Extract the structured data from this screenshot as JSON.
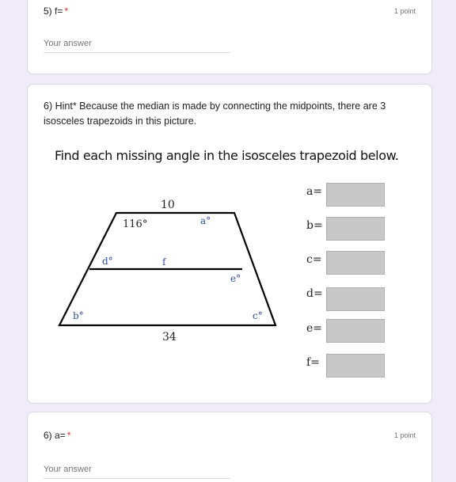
{
  "q5": {
    "title": "5) f=",
    "required_mark": "*",
    "points": "1 point",
    "placeholder": "Your answer"
  },
  "q6_info": {
    "description": "6) Hint* Because the median is made by connecting the midpoints, there are 3 isosceles trapezoids in this picture.",
    "figure": {
      "title": "Find each missing angle in the isosceles trapezoid below.",
      "top_base": "10",
      "bottom_base": "34",
      "median": "f",
      "angle_given": "116°",
      "angle_a": "a°",
      "angle_b": "b°",
      "angle_c": "c°",
      "angle_d": "d°",
      "angle_e": "e°",
      "answers": [
        "a=",
        "b=",
        "c=",
        "d=",
        "e=",
        "f="
      ]
    }
  },
  "q6a": {
    "title": "6) a=",
    "required_mark": "*",
    "points": "1 point",
    "placeholder": "Your answer"
  },
  "colors": {
    "background": "#f0ebf8",
    "required": "#d93025",
    "answer_box": "#c8c8c8",
    "angle_label": "#2a4bb0"
  }
}
